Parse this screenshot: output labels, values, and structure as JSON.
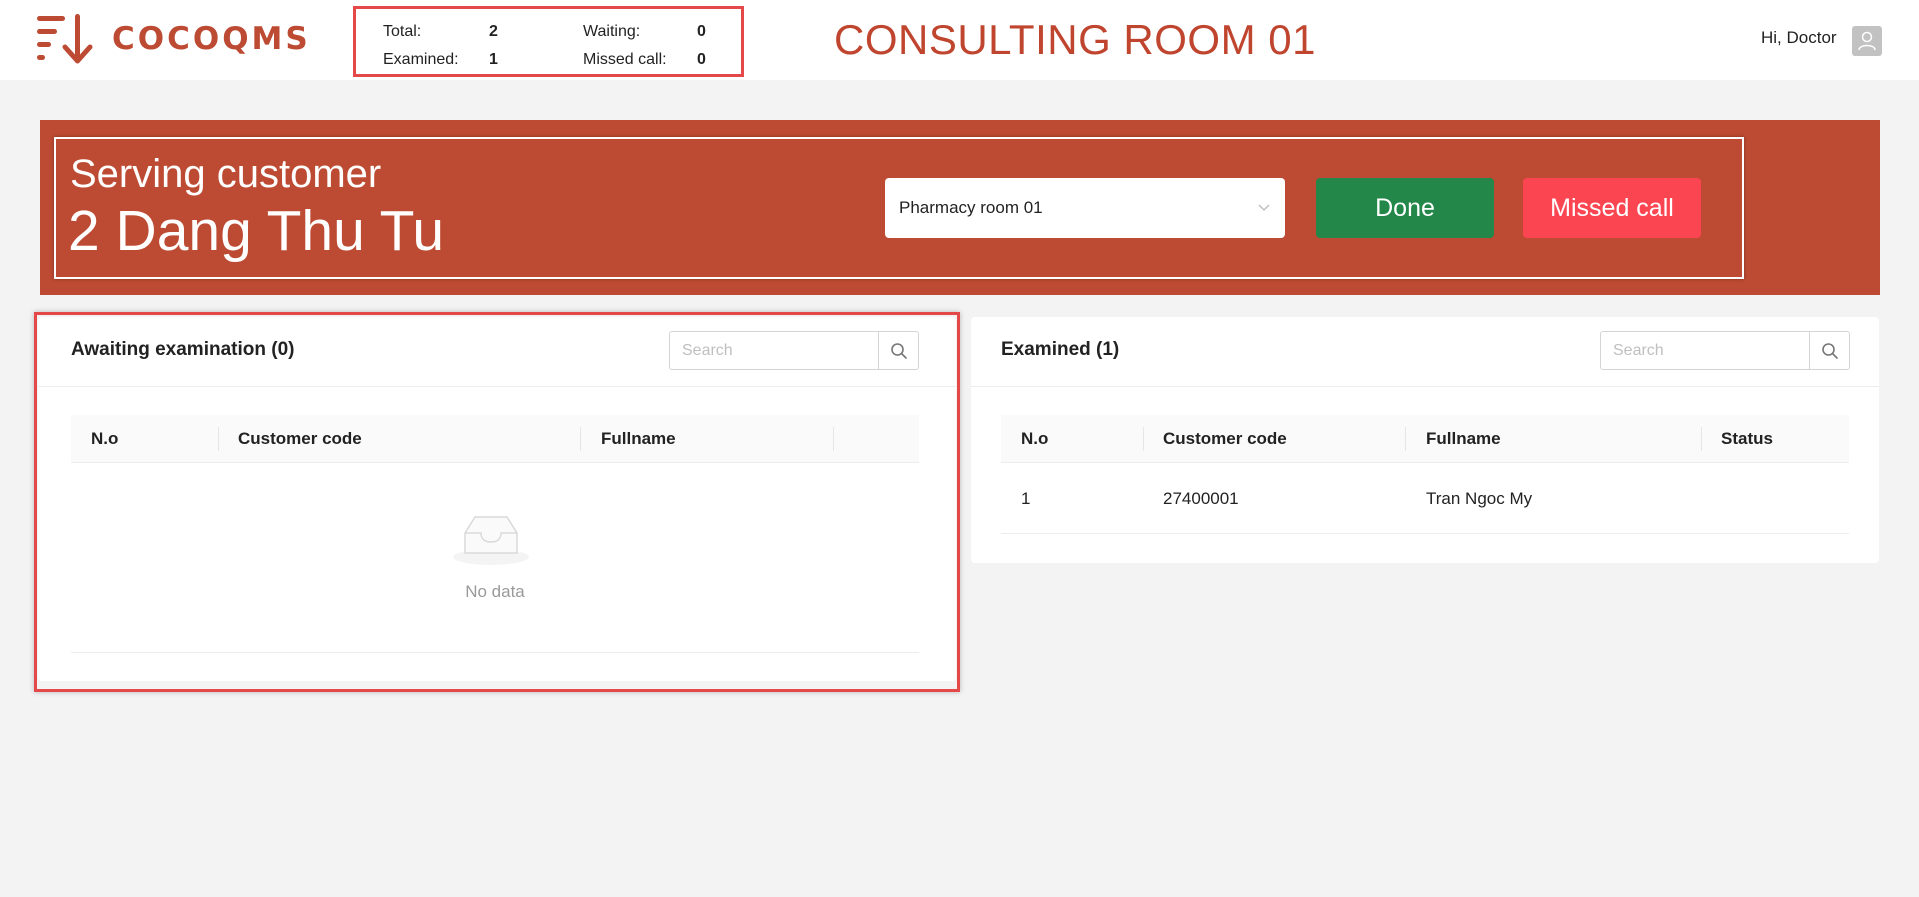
{
  "app": {
    "logo_text": "COCOQMS",
    "greeting": "Hi, Doctor"
  },
  "stats": {
    "total_label": "Total:",
    "total_value": "2",
    "waiting_label": "Waiting:",
    "waiting_value": "0",
    "examined_label": "Examined:",
    "examined_value": "1",
    "missed_label": "Missed call:",
    "missed_value": "0"
  },
  "room_title": "CONSULTING ROOM 01",
  "serving": {
    "label": "Serving customer",
    "customer": "2 Dang Thu Tu",
    "room_select_value": "Pharmacy room 01",
    "done_label": "Done",
    "missed_label": "Missed call"
  },
  "awaiting": {
    "title": "Awaiting examination (0)",
    "search_placeholder": "Search",
    "columns": [
      "N.o",
      "Customer code",
      "Fullname"
    ],
    "empty_text": "No data"
  },
  "examined": {
    "title": "Examined (1)",
    "search_placeholder": "Search",
    "columns": [
      "N.o",
      "Customer code",
      "Fullname",
      "Status"
    ],
    "rows": [
      {
        "no": "1",
        "code": "27400001",
        "name": "Tran Ngoc My",
        "status": ""
      }
    ]
  },
  "colors": {
    "brand": "#bd4a33",
    "banner": "#bd4a32",
    "done": "#238749",
    "missed": "#fb4652",
    "highlight": "#e54848"
  },
  "icons": [
    "menu-arrow-logo-icon",
    "user-icon",
    "chevron-down-icon",
    "search-icon",
    "empty-inbox-icon"
  ]
}
